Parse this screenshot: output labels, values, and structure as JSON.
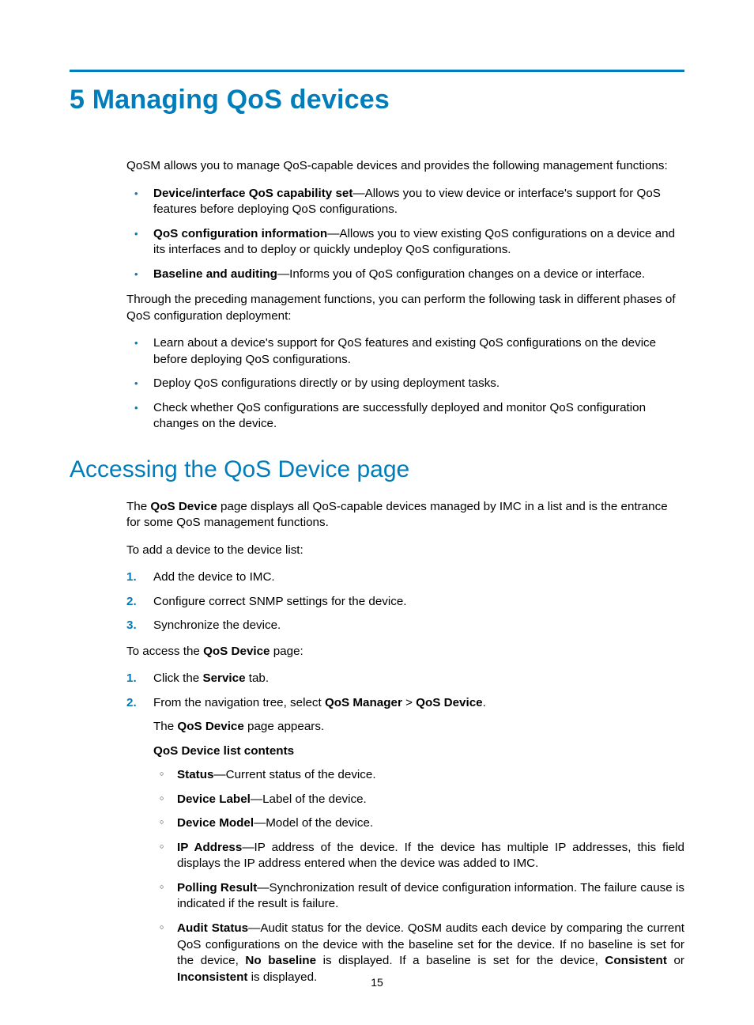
{
  "page_number": "15",
  "h1": "5 Managing QoS devices",
  "intro": "QoSM allows you to manage QoS-capable devices and provides the following management functions:",
  "features": [
    {
      "term": "Device/interface QoS capability set",
      "desc": "—Allows you to view device or interface's support for QoS features before deploying QoS configurations."
    },
    {
      "term": "QoS configuration information",
      "desc": "—Allows you to view existing QoS configurations on a device and its interfaces and to deploy or quickly undeploy QoS configurations."
    },
    {
      "term": "Baseline and auditing",
      "desc": "—Informs you of QoS configuration changes on a device or interface."
    }
  ],
  "phases_intro": "Through the preceding management functions, you can perform the following task in different phases of QoS configuration deployment:",
  "phases": [
    "Learn about a device's support for QoS features and existing QoS configurations on the device before deploying QoS configurations.",
    "Deploy QoS configurations directly or by using deployment tasks.",
    "Check whether QoS configurations are successfully deployed and monitor QoS configuration changes on the device."
  ],
  "h2": "Accessing the QoS Device page",
  "access_intro_pre": "The ",
  "access_intro_bold": "QoS Device",
  "access_intro_post": " page displays all QoS-capable devices managed by IMC in a list and is the entrance for some QoS management functions.",
  "add_device_intro": "To add a device to the device list:",
  "add_steps": [
    "Add the device to IMC.",
    "Configure correct SNMP settings for the device.",
    "Synchronize the device."
  ],
  "access_page_pre": "To access the ",
  "access_page_bold": "QoS Device",
  "access_page_post": " page:",
  "access_steps": {
    "step1_pre": "Click the ",
    "step1_bold": "Service",
    "step1_post": " tab.",
    "step2_pre": "From the navigation tree, select ",
    "step2_b1": "QoS Manager",
    "step2_sep": " > ",
    "step2_b2": "QoS Device",
    "step2_post": ".",
    "step2_sub1_pre": "The ",
    "step2_sub1_bold": "QoS Device",
    "step2_sub1_post": " page appears.",
    "step2_sub2": "QoS Device list contents",
    "fields": [
      {
        "term": "Status",
        "desc": "—Current status of the device."
      },
      {
        "term": "Device Label",
        "desc": "—Label of the device."
      },
      {
        "term": "Device Model",
        "desc": "—Model of the device."
      },
      {
        "term": "IP Address",
        "desc": "—IP address of the device. If the device has multiple IP addresses, this field displays the IP address entered when the device was added to IMC."
      },
      {
        "term": "Polling Result",
        "desc": "—Synchronization result of device configuration information. The failure cause is indicated if the result is failure."
      }
    ],
    "audit_term": "Audit Status",
    "audit_p1": "—Audit status for the device. QoSM audits each device by comparing the current QoS configurations on the device with the baseline set for the device. If no baseline is set for the device, ",
    "audit_b1": "No baseline",
    "audit_p2": " is displayed. If a baseline is set for the device, ",
    "audit_b2": "Consistent",
    "audit_p3": " or ",
    "audit_b3": "Inconsistent",
    "audit_p4": " is displayed."
  }
}
